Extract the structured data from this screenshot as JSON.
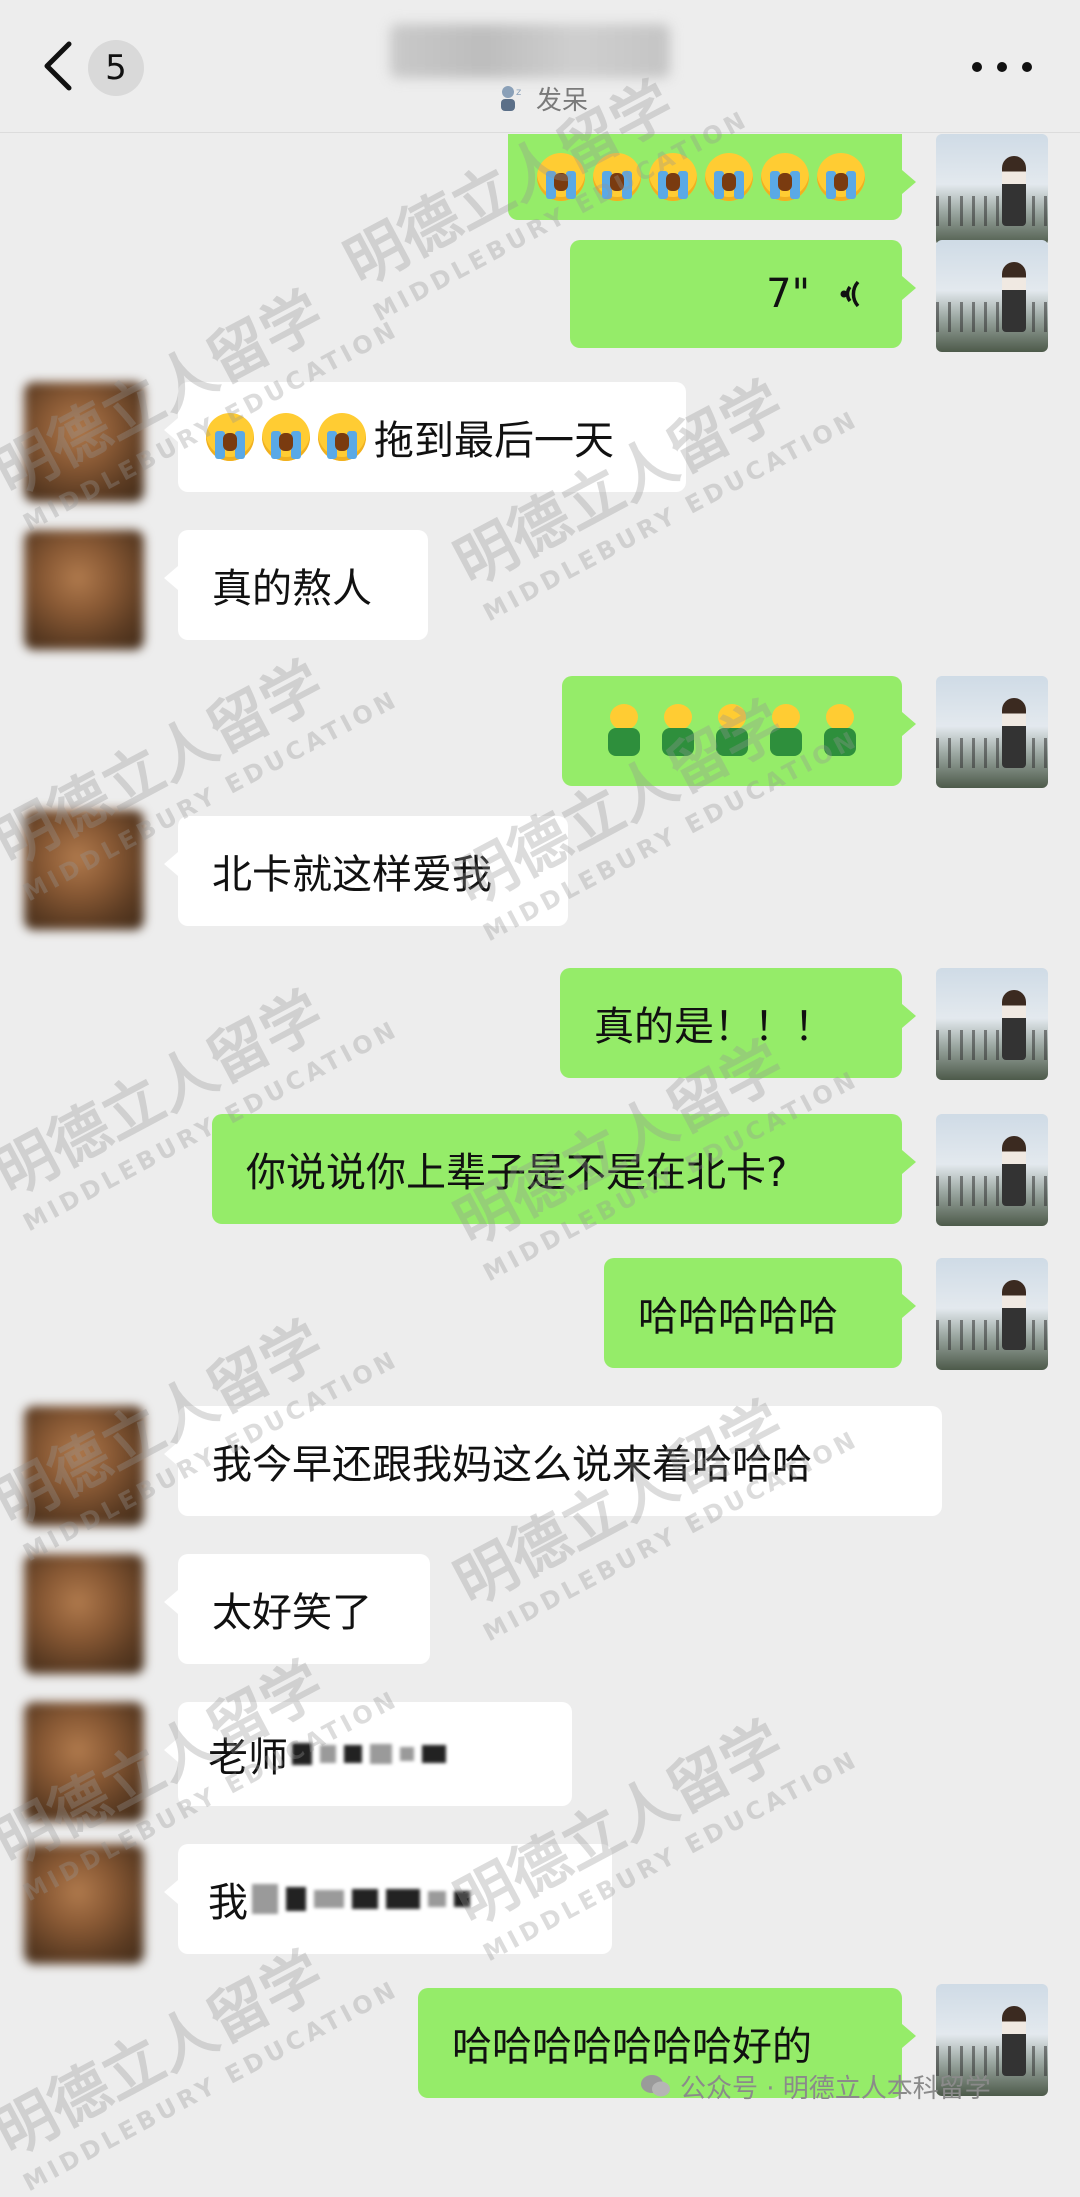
{
  "header": {
    "back_label": "<",
    "unread_count": "5",
    "status_text": "发呆"
  },
  "watermark": {
    "text": "明德立人留学",
    "english": "MIDDLEBURY EDUCATION"
  },
  "messages": [
    {
      "side": "right",
      "type": "emoji",
      "emoji": "loudly-crying-face",
      "count": 6
    },
    {
      "side": "right",
      "type": "voice",
      "duration": "7\""
    },
    {
      "side": "left",
      "type": "text",
      "emoji_prefix": "loudly-crying-face",
      "emoji_count": 3,
      "text": "拖到最后一天"
    },
    {
      "side": "left",
      "type": "text",
      "text": "真的熬人"
    },
    {
      "side": "right",
      "type": "emoji",
      "emoji": "green-doll",
      "count": 5
    },
    {
      "side": "left",
      "type": "text",
      "text": "北卡就这样爱我"
    },
    {
      "side": "right",
      "type": "text",
      "text": "真的是！！！"
    },
    {
      "side": "right",
      "type": "text",
      "text": "你说说你上辈子是不是在北卡?"
    },
    {
      "side": "right",
      "type": "text",
      "text": "哈哈哈哈哈"
    },
    {
      "side": "left",
      "type": "text",
      "text": "我今早还跟我妈这么说来着哈哈哈"
    },
    {
      "side": "left",
      "type": "text",
      "text": "太好笑了"
    },
    {
      "side": "left",
      "type": "text",
      "text": "老师"
    },
    {
      "side": "left",
      "type": "text",
      "text": "我"
    },
    {
      "side": "right",
      "type": "text",
      "text": "哈哈哈哈哈哈哈好的"
    }
  ],
  "footer": {
    "credit": "公众号 · 明德立人本科留学"
  },
  "colors": {
    "background": "#ededed",
    "bubble_self": "#95ec69",
    "bubble_other": "#ffffff"
  }
}
